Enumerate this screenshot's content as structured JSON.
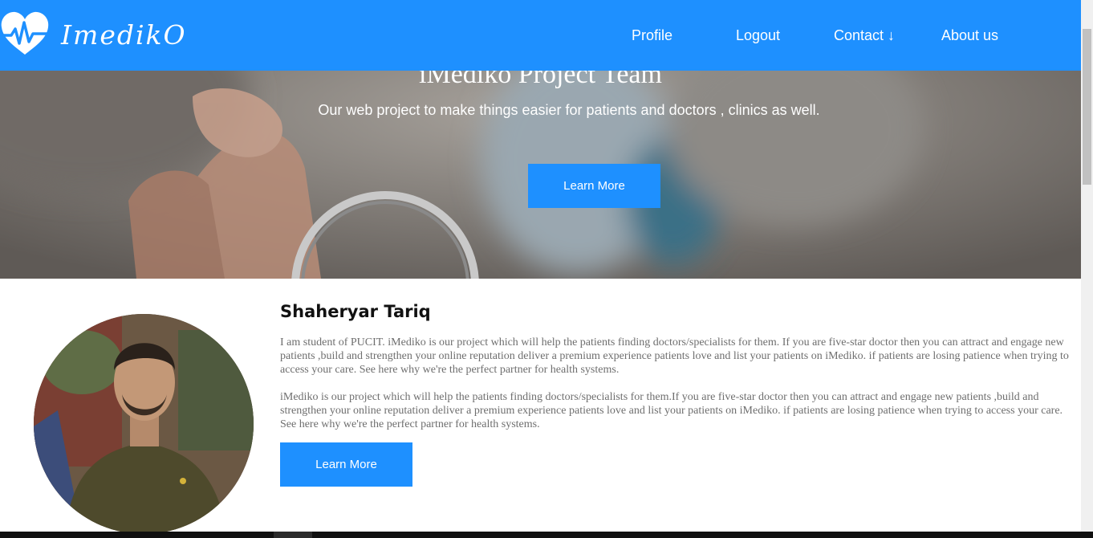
{
  "navbar": {
    "logo_text": "ImedikO",
    "links": [
      {
        "label": "Profile"
      },
      {
        "label": "Logout"
      },
      {
        "label": "Contact ↓"
      },
      {
        "label": "About us"
      }
    ]
  },
  "hero": {
    "title": "iMediko Project Team",
    "subtitle": "Our web project to make things easier for patients and doctors , clinics as well.",
    "button_label": "Learn More"
  },
  "profile": {
    "name": "Shaheryar Tariq",
    "paragraphs": [
      "I am student of PUCIT. iMediko is our project which will help the patients finding doctors/specialists for them. If you are five-star doctor then you can attract and engage new patients ,build and strengthen your online reputation deliver a premium experience patients love and list your patients on iMediko. if patients are losing patience when trying to access your care. See here why we're the perfect partner for health systems.",
      "iMediko is our project which will help the patients finding doctors/specialists for them.If you are five-star doctor then you can attract and engage new patients ,build and strengthen your online reputation deliver a premium experience patients love and list your patients on iMediko. if patients are losing patience when trying to access your care. See here why we're the perfect partner for health systems."
    ],
    "button_label": "Learn More"
  },
  "colors": {
    "brand": "#1e90ff",
    "text_muted": "#6e6e6e"
  },
  "icons": {
    "logo": "heart-pulse-icon"
  }
}
